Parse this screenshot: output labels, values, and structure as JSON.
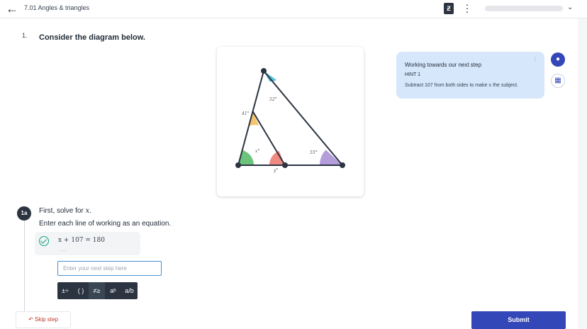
{
  "header": {
    "back_icon": "arrow-left-icon",
    "breadcrumb": "7.01 Angles & triangles",
    "app_icon": "workbook-icon",
    "more_icon": "more-vertical-icon",
    "chevron_icon": "chevron-down-icon"
  },
  "question": {
    "number": "1.",
    "prompt": "Consider the diagram below."
  },
  "diagram": {
    "angle_labels": {
      "top": "52°",
      "left_side": "41°",
      "inner": "x°",
      "right": "55°",
      "bottom": "y°"
    },
    "colors": {
      "top": "#5bc0d8",
      "left_side": "#f5c46b",
      "bottom_left": "#6cc47a",
      "inner": "#f08a80",
      "right": "#b39ddb",
      "line": "#2b3440"
    }
  },
  "hint": {
    "title": "Working towards our next step",
    "label": "HINT 1",
    "body_prefix": "Subtract ",
    "body_number": "107",
    "body_middle": " from both sides to make ",
    "body_var": "x",
    "body_suffix": " the subject."
  },
  "side_buttons": {
    "hint_icon": "lightbulb-icon",
    "book_icon": "book-icon"
  },
  "step": {
    "badge": "1a",
    "title_prefix": "First, solve for ",
    "title_var": "x",
    "title_suffix": ".",
    "instruction": "Enter each line of working as an equation.",
    "answer": "x + 107 = 180",
    "answer_more": "...",
    "input_placeholder": "Enter your next step here"
  },
  "keypad": [
    {
      "name": "operators-key",
      "label": "±÷"
    },
    {
      "name": "brackets-key",
      "label": "( )"
    },
    {
      "name": "relations-key",
      "label": "≠≥"
    },
    {
      "name": "power-key",
      "label": "aᵇ"
    },
    {
      "name": "fraction-key",
      "label": "a/b"
    }
  ],
  "actions": {
    "skip": "Skip step",
    "skip_icon": "skip-icon",
    "submit": "Submit"
  }
}
